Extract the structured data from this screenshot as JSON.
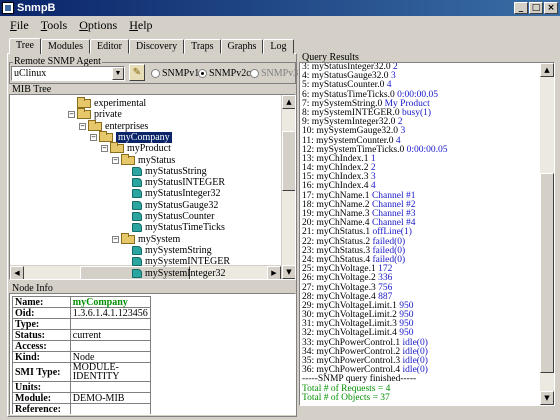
{
  "window": {
    "title": "SnmpB"
  },
  "menu": [
    {
      "label": "File",
      "ul": "F",
      "rest": "ile"
    },
    {
      "label": "Tools",
      "ul": "T",
      "rest": "ools"
    },
    {
      "label": "Options",
      "ul": "O",
      "rest": "ptions"
    },
    {
      "label": "Help",
      "ul": "H",
      "rest": "elp"
    }
  ],
  "tabs": [
    "Tree",
    "Modules",
    "Editor",
    "Discovery",
    "Traps",
    "Graphs",
    "Log"
  ],
  "agent": {
    "group_label": "Remote SNMP Agent",
    "selected": "uClinux",
    "versions": [
      "SNMPv1",
      "SNMPv2c",
      "SNMPv3"
    ],
    "selected_version": "SNMPv2c"
  },
  "mib_tree": {
    "label": "MIB Tree",
    "nodes": [
      {
        "label": "experimental",
        "icon": "folder",
        "expander": "",
        "level": 4
      },
      {
        "label": "private",
        "icon": "folder",
        "expander": "−",
        "level": 4
      },
      {
        "label": "enterprises",
        "icon": "folder",
        "expander": "−",
        "level": 5
      },
      {
        "label": "myCompany",
        "icon": "folder",
        "expander": "−",
        "level": 6,
        "selected": true
      },
      {
        "label": "myProduct",
        "icon": "folder",
        "expander": "−",
        "level": 7
      },
      {
        "label": "myStatus",
        "icon": "folder",
        "expander": "−",
        "level": 8
      },
      {
        "label": "myStatusString",
        "icon": "leaf",
        "expander": "",
        "level": 9
      },
      {
        "label": "myStatusINTEGER",
        "icon": "leaf",
        "expander": "",
        "level": 9
      },
      {
        "label": "myStatusInteger32",
        "icon": "leaf",
        "expander": "",
        "level": 9
      },
      {
        "label": "myStatusGauge32",
        "icon": "leaf",
        "expander": "",
        "level": 9
      },
      {
        "label": "myStatusCounter",
        "icon": "leaf",
        "expander": "",
        "level": 9
      },
      {
        "label": "myStatusTimeTicks",
        "icon": "leaf",
        "expander": "",
        "level": 9
      },
      {
        "label": "mySystem",
        "icon": "folder",
        "expander": "−",
        "level": 8
      },
      {
        "label": "mySystemString",
        "icon": "leaf",
        "expander": "",
        "level": 9
      },
      {
        "label": "mySystemINTEGER",
        "icon": "leaf",
        "expander": "",
        "level": 9
      },
      {
        "label": "mySystemInteger32",
        "icon": "leaf",
        "expander": "",
        "level": 9
      }
    ]
  },
  "node_info": {
    "label": "Node Info",
    "rows": [
      {
        "key": "Name:",
        "value": "myCompany",
        "highlight": true
      },
      {
        "key": "Oid:",
        "value": "1.3.6.1.4.1.123456"
      },
      {
        "key": "Type:",
        "value": ""
      },
      {
        "key": "Status:",
        "value": "current"
      },
      {
        "key": "Access:",
        "value": ""
      },
      {
        "key": "Kind:",
        "value": "Node"
      },
      {
        "key": "SMI Type:",
        "value": "MODULE-IDENTITY"
      },
      {
        "key": "Units:",
        "value": ""
      },
      {
        "key": "Module:",
        "value": "DEMO-MIB"
      },
      {
        "key": "Reference:",
        "value": ""
      },
      {
        "key": "Description:",
        "value": ""
      }
    ]
  },
  "query_results": {
    "label": "Query Results",
    "lines": [
      {
        "name": "3: myStatusInteger32.0",
        "value": "2"
      },
      {
        "name": "4: myStatusGauge32.0",
        "value": "3"
      },
      {
        "name": "5: myStatusCounter.0",
        "value": "4"
      },
      {
        "name": "6: myStatusTimeTicks.0",
        "value": "0:00:00.05"
      },
      {
        "name": "7: mySystemString.0",
        "value": "My Product"
      },
      {
        "name": "8: mySystemINTEGER.0",
        "value": "busy(1)"
      },
      {
        "name": "9: mySystemInteger32.0",
        "value": "2"
      },
      {
        "name": "10: mySystemGauge32.0",
        "value": "3"
      },
      {
        "name": "11: mySystemCounter.0",
        "value": "4"
      },
      {
        "name": "12: mySystemTimeTicks.0",
        "value": "0:00:00.05"
      },
      {
        "name": "13: myChIndex.1",
        "value": "1"
      },
      {
        "name": "14: myChIndex.2",
        "value": "2"
      },
      {
        "name": "15: myChIndex.3",
        "value": "3"
      },
      {
        "name": "16: myChIndex.4",
        "value": "4"
      },
      {
        "name": "17: myChName.1",
        "value": "Channel #1"
      },
      {
        "name": "18: myChName.2",
        "value": "Channel #2"
      },
      {
        "name": "19: myChName.3",
        "value": "Channel #3"
      },
      {
        "name": "20: myChName.4",
        "value": "Channel #4"
      },
      {
        "name": "21: myChStatus.1",
        "value": "offLine(1)"
      },
      {
        "name": "22: myChStatus.2",
        "value": "failed(0)"
      },
      {
        "name": "23: myChStatus.3",
        "value": "failed(0)"
      },
      {
        "name": "24: myChStatus.4",
        "value": "failed(0)"
      },
      {
        "name": "25: myChVoltage.1",
        "value": "172"
      },
      {
        "name": "26: myChVoltage.2",
        "value": "336"
      },
      {
        "name": "27: myChVoltage.3",
        "value": "756"
      },
      {
        "name": "28: myChVoltage.4",
        "value": "887"
      },
      {
        "name": "29: myChVoltageLimit.1",
        "value": "950"
      },
      {
        "name": "30: myChVoltageLimit.2",
        "value": "950"
      },
      {
        "name": "31: myChVoltageLimit.3",
        "value": "950"
      },
      {
        "name": "32: myChVoltageLimit.4",
        "value": "950"
      },
      {
        "name": "33: myChPowerControl.1",
        "value": "idle(0)"
      },
      {
        "name": "34: myChPowerControl.2",
        "value": "idle(0)"
      },
      {
        "name": "35: myChPowerControl.3",
        "value": "idle(0)"
      },
      {
        "name": "36: myChPowerControl.4",
        "value": "idle(0)"
      }
    ],
    "footer": [
      {
        "text": "-----SNMP query finished-----",
        "color": "#000000"
      },
      {
        "text": "Total # of Requests = 4",
        "color": "#009000"
      },
      {
        "text": "Total # of Objects = 37",
        "color": "#009000"
      }
    ]
  },
  "colors": {
    "title_bar": "#0a246a",
    "selection": "#0a246a",
    "value_text": "#1818c8",
    "footer_text": "#009000",
    "folder": "#e6c86b",
    "leaf": "#2aa5a0"
  }
}
